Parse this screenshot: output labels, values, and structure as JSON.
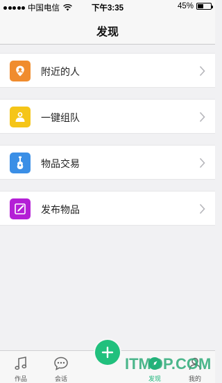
{
  "status_bar": {
    "carrier": "中国电信",
    "time": "下午3:35",
    "battery_percent": "45%",
    "battery_level": 0.45
  },
  "nav": {
    "title": "发现"
  },
  "menu": [
    {
      "label": "附近的人",
      "icon": "location-pin-icon",
      "color": "#f08c2e"
    },
    {
      "label": "一键组队",
      "icon": "team-icon",
      "color": "#f5c518"
    },
    {
      "label": "物品交易",
      "icon": "guitar-icon",
      "color": "#3b8fe6"
    },
    {
      "label": "发布物品",
      "icon": "edit-note-icon",
      "color": "#b41fd6"
    }
  ],
  "tabs": [
    {
      "label": "作品",
      "icon": "music-note-icon",
      "active": false
    },
    {
      "label": "会话",
      "icon": "chat-bubble-icon",
      "active": false
    },
    {
      "label": "发现",
      "icon": "discover-icon",
      "active": true
    },
    {
      "label": "我的",
      "icon": "profile-icon",
      "active": false
    }
  ],
  "fab": {
    "icon": "plus-icon",
    "color": "#21c07d"
  },
  "watermark": "ITMOP.COM",
  "colors": {
    "accent": "#1db57a",
    "background": "#f1f1f3"
  }
}
